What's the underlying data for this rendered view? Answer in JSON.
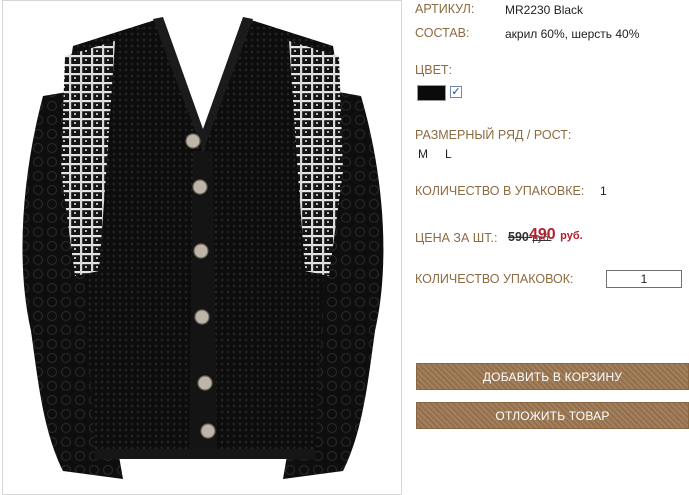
{
  "product": {
    "article_label": "АРТИКУЛ:",
    "article_value": "MR2230 Black",
    "composition_label": "СОСТАВ:",
    "composition_value": "акрил 60%, шерсть 40%",
    "color_label": "ЦВЕТ:",
    "color_swatch": "#0b0b0b",
    "color_checked": "✓",
    "sizes_label": "РАЗМЕРНЫЙ РЯД / РОСТ:",
    "sizes": [
      "M",
      "L"
    ],
    "pack_qty_label": "КОЛИЧЕСТВО В УПАКОВКЕ:",
    "pack_qty_value": "1",
    "price_label": "ЦЕНА ЗА ШТ.:",
    "old_price": "590",
    "old_currency": "руб.",
    "new_price": "490",
    "new_currency": "руб.",
    "packs_label": "КОЛИЧЕСТВО УПАКОВОК:",
    "packs_value": "1"
  },
  "buttons": {
    "add_to_cart": "ДОБАВИТЬ В КОРЗИНУ",
    "postpone": "ОТЛОЖИТЬ ТОВАР"
  },
  "colors": {
    "label": "#8c6b42",
    "price_new": "#b3212c",
    "button_bg": "#9b7650"
  }
}
